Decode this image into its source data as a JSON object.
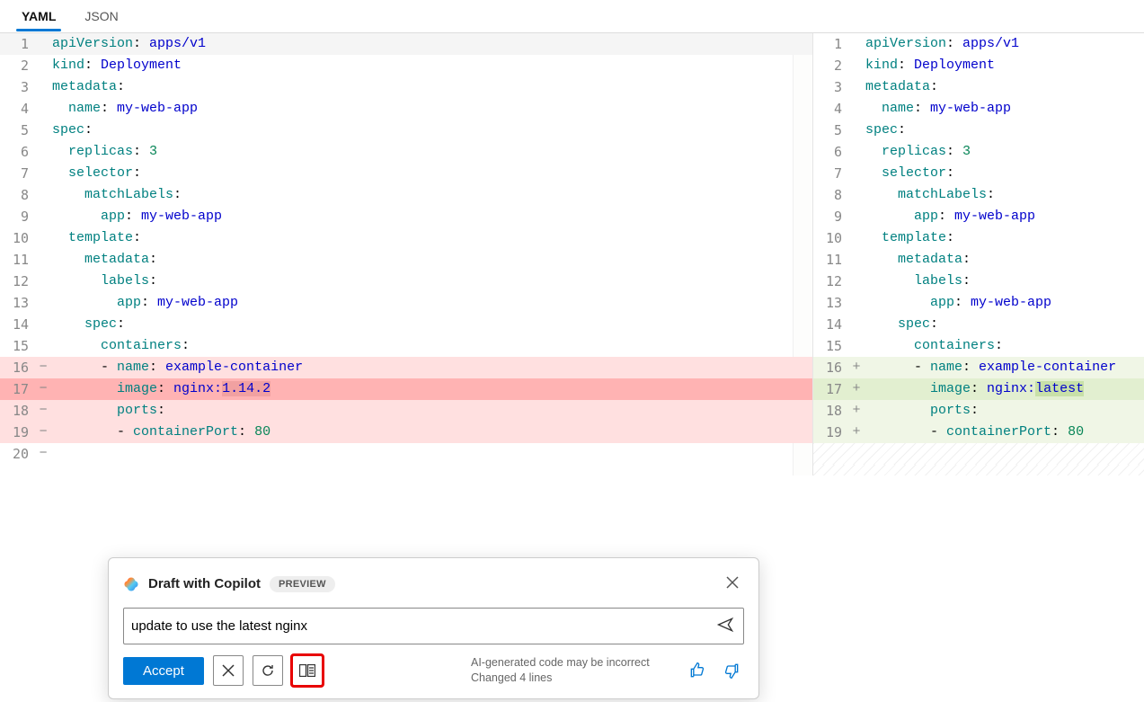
{
  "tabs": {
    "yaml": "YAML",
    "json": "JSON"
  },
  "left": {
    "lines": [
      {
        "n": 1,
        "m": "",
        "cls": "",
        "html": "<span class='k-key'>apiVersion</span>: <span class='k-val'>apps/v1</span>"
      },
      {
        "n": 2,
        "m": "",
        "cls": "",
        "html": "<span class='k-key'>kind</span>: <span class='k-val'>Deployment</span>"
      },
      {
        "n": 3,
        "m": "",
        "cls": "",
        "html": "<span class='k-key'>metadata</span>:"
      },
      {
        "n": 4,
        "m": "",
        "cls": "",
        "html": "  <span class='k-key'>name</span>: <span class='k-val'>my-web-app</span>"
      },
      {
        "n": 5,
        "m": "",
        "cls": "",
        "html": "<span class='k-key'>spec</span>:"
      },
      {
        "n": 6,
        "m": "",
        "cls": "",
        "html": "  <span class='k-key'>replicas</span>: <span class='k-num'>3</span>"
      },
      {
        "n": 7,
        "m": "",
        "cls": "",
        "html": "  <span class='k-key'>selector</span>:"
      },
      {
        "n": 8,
        "m": "",
        "cls": "",
        "html": "    <span class='k-key'>matchLabels</span>:"
      },
      {
        "n": 9,
        "m": "",
        "cls": "",
        "html": "      <span class='k-key'>app</span>: <span class='k-val'>my-web-app</span>"
      },
      {
        "n": 10,
        "m": "",
        "cls": "",
        "html": "  <span class='k-key'>template</span>:"
      },
      {
        "n": 11,
        "m": "",
        "cls": "",
        "html": "    <span class='k-key'>metadata</span>:"
      },
      {
        "n": 12,
        "m": "",
        "cls": "",
        "html": "      <span class='k-key'>labels</span>:"
      },
      {
        "n": 13,
        "m": "",
        "cls": "",
        "html": "        <span class='k-key'>app</span>: <span class='k-val'>my-web-app</span>"
      },
      {
        "n": 14,
        "m": "",
        "cls": "",
        "html": "    <span class='k-key'>spec</span>:"
      },
      {
        "n": 15,
        "m": "",
        "cls": "",
        "html": "      <span class='k-key'>containers</span>:"
      },
      {
        "n": 16,
        "m": "−",
        "cls": "del-light",
        "html": "      - <span class='k-key'>name</span>: <span class='k-val'>example-container</span>"
      },
      {
        "n": 17,
        "m": "−",
        "cls": "del",
        "html": "        <span class='k-key'>image</span>: <span class='k-val'>nginx:<span class='hl-change'>1.14.2</span></span>"
      },
      {
        "n": 18,
        "m": "−",
        "cls": "del-light",
        "html": "        <span class='k-key'>ports</span>:"
      },
      {
        "n": 19,
        "m": "−",
        "cls": "del-light",
        "html": "        - <span class='k-key'>containerPort</span>: <span class='k-num'>80</span>"
      },
      {
        "n": 20,
        "m": "−",
        "cls": "",
        "html": ""
      }
    ]
  },
  "right": {
    "lines": [
      {
        "n": 1,
        "m": "",
        "cls": "",
        "html": "<span class='k-key'>apiVersion</span>: <span class='k-val'>apps/v1</span>"
      },
      {
        "n": 2,
        "m": "",
        "cls": "",
        "html": "<span class='k-key'>kind</span>: <span class='k-val'>Deployment</span>"
      },
      {
        "n": 3,
        "m": "",
        "cls": "",
        "html": "<span class='k-key'>metadata</span>:"
      },
      {
        "n": 4,
        "m": "",
        "cls": "",
        "html": "  <span class='k-key'>name</span>: <span class='k-val'>my-web-app</span>"
      },
      {
        "n": 5,
        "m": "",
        "cls": "",
        "html": "<span class='k-key'>spec</span>:"
      },
      {
        "n": 6,
        "m": "",
        "cls": "",
        "html": "  <span class='k-key'>replicas</span>: <span class='k-num'>3</span>"
      },
      {
        "n": 7,
        "m": "",
        "cls": "",
        "html": "  <span class='k-key'>selector</span>:"
      },
      {
        "n": 8,
        "m": "",
        "cls": "",
        "html": "    <span class='k-key'>matchLabels</span>:"
      },
      {
        "n": 9,
        "m": "",
        "cls": "",
        "html": "      <span class='k-key'>app</span>: <span class='k-val'>my-web-app</span>"
      },
      {
        "n": 10,
        "m": "",
        "cls": "",
        "html": "  <span class='k-key'>template</span>:"
      },
      {
        "n": 11,
        "m": "",
        "cls": "",
        "html": "    <span class='k-key'>metadata</span>:"
      },
      {
        "n": 12,
        "m": "",
        "cls": "",
        "html": "      <span class='k-key'>labels</span>:"
      },
      {
        "n": 13,
        "m": "",
        "cls": "",
        "html": "        <span class='k-key'>app</span>: <span class='k-val'>my-web-app</span>"
      },
      {
        "n": 14,
        "m": "",
        "cls": "",
        "html": "    <span class='k-key'>spec</span>:"
      },
      {
        "n": 15,
        "m": "",
        "cls": "",
        "html": "      <span class='k-key'>containers</span>:"
      },
      {
        "n": 16,
        "m": "+",
        "cls": "add-light",
        "html": "      - <span class='k-key'>name</span>: <span class='k-val'>example-container</span>"
      },
      {
        "n": 17,
        "m": "+",
        "cls": "add",
        "html": "        <span class='k-key'>image</span>: <span class='k-val'>nginx:<span class='hl-change-add'>latest</span></span>"
      },
      {
        "n": 18,
        "m": "+",
        "cls": "add-light",
        "html": "        <span class='k-key'>ports</span>:"
      },
      {
        "n": 19,
        "m": "+",
        "cls": "add-light",
        "html": "        - <span class='k-key'>containerPort</span>: <span class='k-num'>80</span>"
      }
    ]
  },
  "copilot": {
    "title": "Draft with Copilot",
    "badge": "PREVIEW",
    "input": "update to use the latest nginx",
    "accept": "Accept",
    "note1": "AI-generated code may be incorrect",
    "note2": "Changed 4 lines"
  }
}
